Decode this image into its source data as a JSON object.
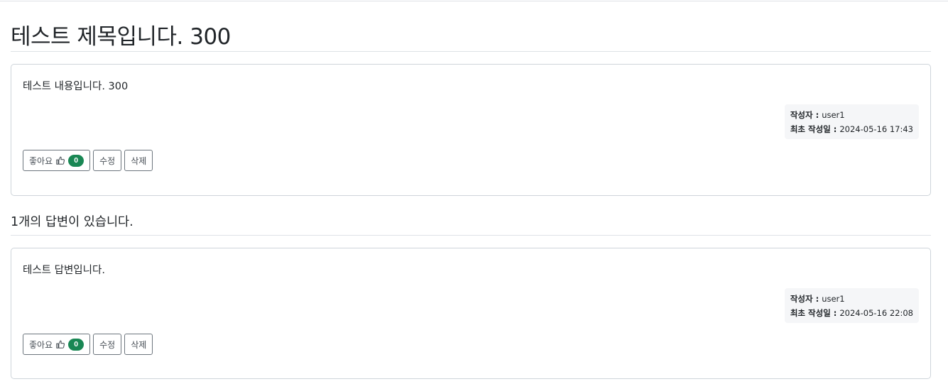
{
  "question": {
    "title": "테스트 제목입니다. 300",
    "content": "테스트 내용입니다. 300",
    "author_label": "작성자 : ",
    "author": "user1",
    "date_label": "최초 작성일 : ",
    "created": "2024-05-16 17:43",
    "like_label": "좋아요",
    "like_count": "0",
    "edit_label": "수정",
    "delete_label": "삭제"
  },
  "answer_count_text": "1개의 답변이 있습니다.",
  "answers": [
    {
      "content": "테스트 답변입니다.",
      "author_label": "작성자 : ",
      "author": "user1",
      "date_label": "최초 작성일 : ",
      "created": "2024-05-16 22:08",
      "like_label": "좋아요",
      "like_count": "0",
      "edit_label": "수정",
      "delete_label": "삭제"
    }
  ],
  "colors": {
    "badge": "#198754",
    "border": "#ced4da",
    "meta_bg": "#f5f6f8"
  },
  "icons": [
    "thumbs-up-icon"
  ]
}
